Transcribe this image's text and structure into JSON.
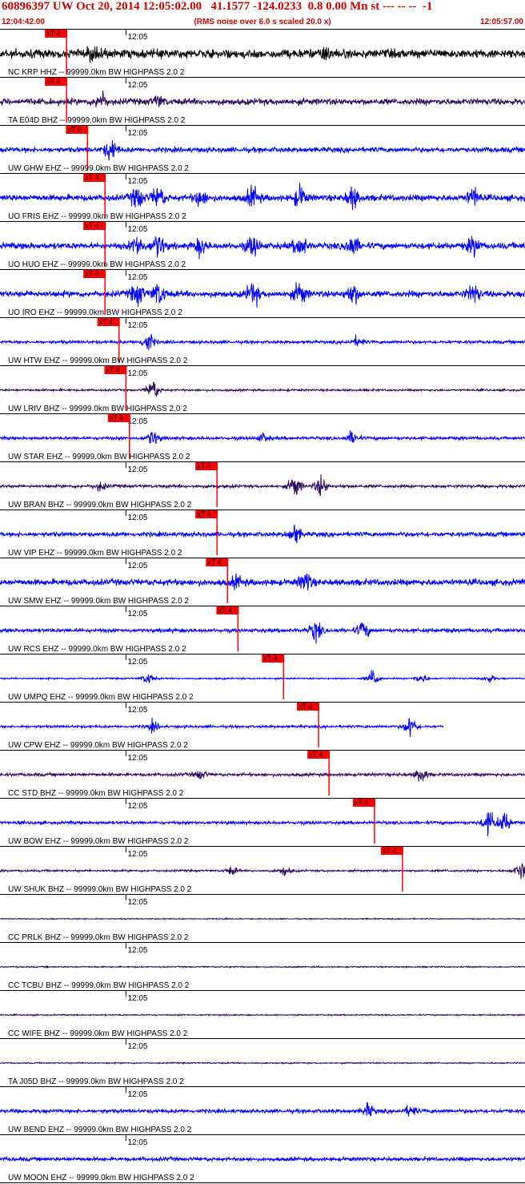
{
  "header": {
    "title": "60896397 UW Oct 20, 2014 12:05:02.00   41.1577 -124.0233  0.8 0.00 Mn st --- -- --  -1",
    "start_time": "12:04:42.00",
    "subtitle": "(RMS noise over 6.0 s scaled 20.0 x)",
    "end_time": "12:05:57.00"
  },
  "colors": {
    "header_text": "#cc0000",
    "pick": "#ff0000",
    "blue": "#0000ff",
    "purple": "#2e0a5e",
    "black": "#000000"
  },
  "chart_data": {
    "type": "line",
    "title": "60896397 UW Oct 20, 2014 12:05:02.00   41.1577 -124.0233  0.8 0.00 Mn st --- -- --  -1",
    "xlabel": "",
    "ylabel": "",
    "x_range": [
      "12:04:42.00",
      "12:05:57.00"
    ],
    "tick_label": "12:05",
    "pick_label": "xT 4",
    "series": [
      {
        "name": "NC KRP HHZ -- 99999.0km BW  HIGHPASS  2.0  2",
        "color": "black",
        "pick": "12:04:51.5",
        "amp": 0.35,
        "bursts": [
          [
            0.18,
            0.75
          ],
          [
            0.62,
            0.45
          ]
        ]
      },
      {
        "name": "TA E04D BHZ -- 99999.0km BW  HIGHPASS  2.0  2",
        "color": "purple",
        "pick": "12:04:51.5",
        "amp": 0.25,
        "bursts": [
          [
            0.19,
            0.75
          ],
          [
            0.3,
            0.4
          ]
        ]
      },
      {
        "name": "UW GHW EHZ -- 99999.0km BW  HIGHPASS  2.0  2",
        "color": "blue",
        "pick": "12:04:54.5",
        "amp": 0.2,
        "bursts": [
          [
            0.21,
            0.9
          ]
        ]
      },
      {
        "name": "UO FRIS EHZ -- 99999.0km BW  HIGHPASS  2.0  2",
        "color": "blue",
        "pick": "12:04:57.0",
        "amp": 0.25,
        "bursts": [
          [
            0.26,
            0.95
          ],
          [
            0.3,
            1.0
          ],
          [
            0.38,
            0.7
          ],
          [
            0.48,
            0.9
          ],
          [
            0.57,
            1.0
          ],
          [
            0.67,
            0.9
          ],
          [
            0.9,
            0.8
          ]
        ]
      },
      {
        "name": "UO HUO EHZ -- 99999.0km BW  HIGHPASS  2.0  2",
        "color": "blue",
        "pick": "12:04:57.0",
        "amp": 0.25,
        "bursts": [
          [
            0.26,
            0.95
          ],
          [
            0.3,
            1.0
          ],
          [
            0.38,
            0.7
          ],
          [
            0.48,
            0.9
          ],
          [
            0.57,
            1.0
          ],
          [
            0.67,
            0.9
          ],
          [
            0.9,
            0.8
          ]
        ]
      },
      {
        "name": "UO IRO EHZ -- 99999.0km BW  HIGHPASS  2.0  2",
        "color": "blue",
        "pick": "12:04:57.0",
        "amp": 0.25,
        "bursts": [
          [
            0.26,
            0.95
          ],
          [
            0.3,
            1.0
          ],
          [
            0.48,
            1.0
          ],
          [
            0.57,
            1.0
          ],
          [
            0.67,
            0.9
          ],
          [
            0.9,
            0.8
          ]
        ]
      },
      {
        "name": "UW HTW EHZ -- 99999.0km BW  HIGHPASS  2.0  2",
        "color": "blue",
        "pick": "12:04:59.0",
        "amp": 0.12,
        "bursts": [
          [
            0.28,
            0.8
          ],
          [
            0.68,
            0.35
          ]
        ]
      },
      {
        "name": "UW LRIV BHZ -- 99999.0km BW  HIGHPASS  2.0  2",
        "color": "purple",
        "pick": "12:05:00.0",
        "amp": 0.08,
        "bursts": [
          [
            0.29,
            0.9
          ]
        ]
      },
      {
        "name": "UW STAR EHZ -- 99999.0km BW  HIGHPASS  2.0  2",
        "color": "blue",
        "pick": "12:05:00.5",
        "amp": 0.12,
        "bursts": [
          [
            0.29,
            0.6
          ],
          [
            0.5,
            0.35
          ],
          [
            0.67,
            0.5
          ]
        ]
      },
      {
        "name": "UW BRAN BHZ -- 99999.0km BW  HIGHPASS  2.0  2",
        "color": "purple",
        "pick": "12:05:13.0",
        "amp": 0.12,
        "bursts": [
          [
            0.19,
            0.35
          ],
          [
            0.56,
            0.9
          ],
          [
            0.61,
            0.8
          ]
        ]
      },
      {
        "name": "UW VIP EHZ -- 99999.0km BW  HIGHPASS  2.0  2",
        "color": "blue",
        "pick": "12:05:13.0",
        "amp": 0.18,
        "bursts": [
          [
            0.56,
            0.8
          ]
        ]
      },
      {
        "name": "UW SMW EHZ -- 99999.0km BW  HIGHPASS  2.0  2",
        "color": "blue",
        "pick": "12:05:14.5",
        "amp": 0.25,
        "bursts": [
          [
            0.45,
            0.45
          ],
          [
            0.58,
            0.85
          ]
        ]
      },
      {
        "name": "UW RCS EHZ -- 99999.0km BW  HIGHPASS  2.0  2",
        "color": "blue",
        "pick": "12:05:16.0",
        "amp": 0.15,
        "bursts": [
          [
            0.6,
            0.8
          ],
          [
            0.69,
            0.7
          ]
        ]
      },
      {
        "name": "UW UMPQ EHZ -- 99999.0km BW  HIGHPASS  2.0  2",
        "color": "blue",
        "pick": "12:05:22.5",
        "amp": 0.06,
        "bursts": [
          [
            0.28,
            0.45
          ],
          [
            0.71,
            0.7
          ],
          [
            0.8,
            0.4
          ],
          [
            0.93,
            0.3
          ]
        ]
      },
      {
        "name": "UW CPW EHZ -- 99999.0km BW  HIGHPASS  2.0  2",
        "color": "blue",
        "pick": "12:05:27.5",
        "amp": 0.1,
        "bursts": [
          [
            0.29,
            0.4
          ],
          [
            0.78,
            0.9
          ]
        ],
        "end_frac": 0.845
      },
      {
        "name": "CC STD BHZ -- 99999.0km BW  HIGHPASS  2.0  2",
        "color": "purple",
        "pick": "12:05:29.0",
        "amp": 0.12,
        "bursts": [
          [
            0.38,
            0.35
          ],
          [
            0.8,
            0.6
          ]
        ]
      },
      {
        "name": "UW BOW EHZ -- 99999.0km BW  HIGHPASS  2.0  2",
        "color": "blue",
        "pick": "12:05:35.5",
        "amp": 0.12,
        "bursts": [
          [
            0.93,
            1.0
          ],
          [
            0.96,
            0.8
          ]
        ]
      },
      {
        "name": "UW SHUK BHZ -- 99999.0km BW  HIGHPASS  2.0  2",
        "color": "purple",
        "pick": "12:05:39.5",
        "amp": 0.08,
        "bursts": [
          [
            0.44,
            0.3
          ],
          [
            0.54,
            0.35
          ],
          [
            0.99,
            0.8
          ]
        ]
      },
      {
        "name": "CC PRLK BHZ -- 99999.0km BW  HIGHPASS  2.0  2",
        "color": "purple",
        "amp": 0.04,
        "bursts": []
      },
      {
        "name": "CC TCBU BHZ -- 99999.0km BW  HIGHPASS  2.0  2",
        "color": "purple",
        "amp": 0.05,
        "bursts": []
      },
      {
        "name": "CC WIFE BHZ -- 99999.0km BW  HIGHPASS  2.0  2",
        "color": "purple",
        "amp": 0.05,
        "bursts": []
      },
      {
        "name": "TA J05D BHZ -- 99999.0km BW  HIGHPASS  2.0  2",
        "color": "purple",
        "amp": 0.05,
        "bursts": []
      },
      {
        "name": "UW BEND EHZ -- 99999.0km BW  HIGHPASS  2.0  2",
        "color": "blue",
        "amp": 0.15,
        "bursts": [
          [
            0.7,
            0.5
          ],
          [
            0.78,
            0.45
          ]
        ]
      },
      {
        "name": "UW MOON EHZ -- 99999.0km BW  HIGHPASS  2.0  2",
        "color": "blue",
        "amp": 0.15,
        "bursts": []
      }
    ]
  }
}
